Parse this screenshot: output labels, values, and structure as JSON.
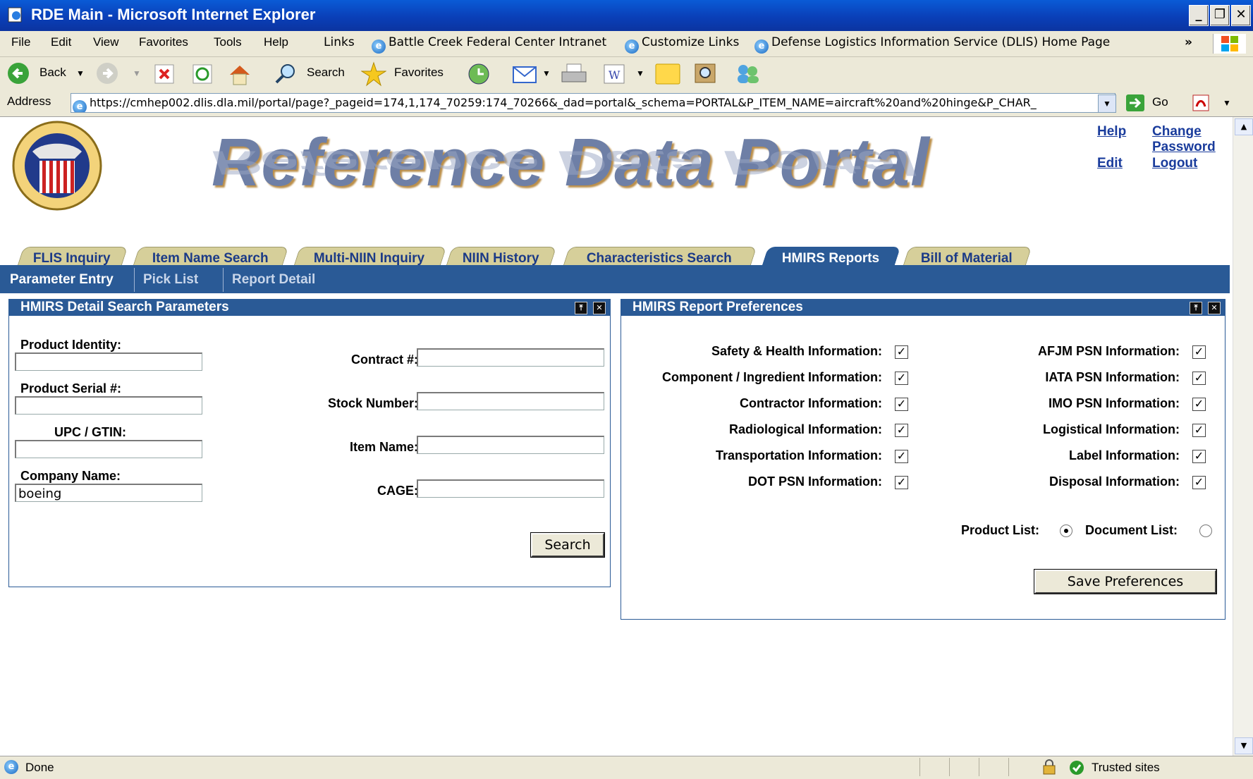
{
  "window": {
    "title": "RDE Main - Microsoft Internet Explorer"
  },
  "menu": [
    "File",
    "Edit",
    "View",
    "Favorites",
    "Tools",
    "Help"
  ],
  "links_label": "Links",
  "links": [
    "Battle Creek Federal Center Intranet",
    "Customize Links",
    "Defense Logistics Information Service (DLIS) Home Page"
  ],
  "toolbar": {
    "back": "Back",
    "search": "Search",
    "favorites": "Favorites"
  },
  "address": {
    "label": "Address",
    "url": "https://cmhep002.dlis.dla.mil/portal/page?_pageid=174,1,174_70259:174_70266&_dad=portal&_schema=PORTAL&P_ITEM_NAME=aircraft%20and%20hinge&P_CHAR_",
    "go": "Go"
  },
  "portal": {
    "banner": "Reference Data Portal",
    "links": {
      "help": "Help",
      "change_password": "Change Password",
      "edit": "Edit",
      "logout": "Logout"
    },
    "tabs": [
      "FLIS Inquiry",
      "Item Name Search",
      "Multi-NIIN Inquiry",
      "NIIN History",
      "Characteristics Search",
      "HMIRS Reports",
      "Bill of Material"
    ],
    "active_tab": "HMIRS Reports",
    "subtabs": [
      "Parameter Entry",
      "Pick List",
      "Report Detail"
    ]
  },
  "search_panel": {
    "title": "HMIRS Detail Search Parameters",
    "product_identity": {
      "label": "Product Identity:",
      "value": ""
    },
    "product_serial": {
      "label": "Product Serial #:",
      "value": ""
    },
    "upc": {
      "label": "UPC / GTIN:",
      "value": ""
    },
    "company": {
      "label": "Company Name:",
      "value": "boeing"
    },
    "contract": {
      "label": "Contract #:",
      "value": ""
    },
    "stock": {
      "label": "Stock Number:",
      "value": ""
    },
    "item_name": {
      "label": "Item Name:",
      "value": ""
    },
    "cage": {
      "label": "CAGE:",
      "value": ""
    },
    "search_button": "Search"
  },
  "prefs_panel": {
    "title": "HMIRS Report Preferences",
    "left": [
      "Safety & Health Information:",
      "Component / Ingredient Information:",
      "Contractor Information:",
      "Radiological Information:",
      "Transportation Information:",
      "DOT PSN Information:"
    ],
    "right": [
      "AFJM PSN Information:",
      "IATA PSN Information:",
      "IMO PSN Information:",
      "Logistical Information:",
      "Label Information:",
      "Disposal Information:"
    ],
    "product_list": "Product List:",
    "document_list": "Document List:",
    "selected_list": "Product List",
    "save_button": "Save Preferences"
  },
  "status": {
    "text": "Done",
    "zone": "Trusted sites"
  }
}
